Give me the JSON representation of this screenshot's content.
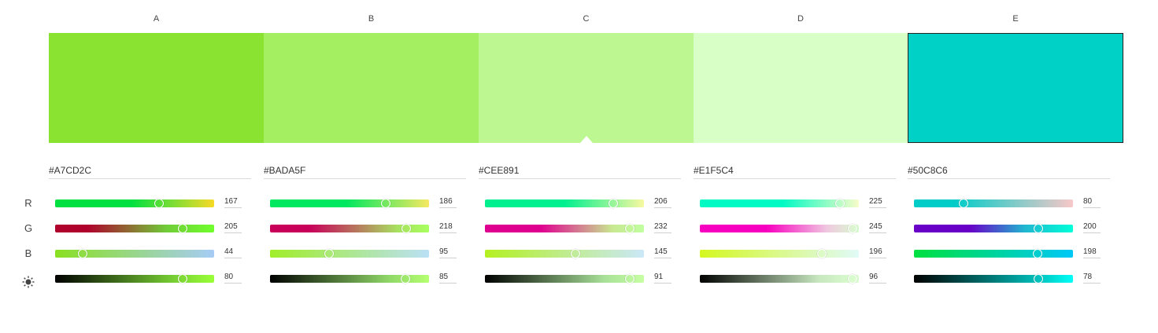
{
  "row_labels": [
    "R",
    "G",
    "B"
  ],
  "brightness_icon": "sun-icon",
  "selected_index": 4,
  "caret_under_index": 2,
  "swatches": [
    {
      "label": "A",
      "color": "#8AE231",
      "hex": "#A7CD2C",
      "r": 167,
      "g": 205,
      "b": 44,
      "brightness": 80,
      "gradients": {
        "r": "linear-gradient(to right,#00E040 0%,#00E040 48%,#F8DA28 100%)",
        "g": "linear-gradient(to right,#B0002C 0%,#B0002C 20%,#70CC38 70%,#70FF2C 100%)",
        "b": "linear-gradient(to right,#8AE020 0%,#A6CCF6 100%)",
        "br": "linear-gradient(to right,#000000 0%,#78D034 75%,#9AFF36 100%)"
      }
    },
    {
      "label": "B",
      "color": "#A3EF61",
      "hex": "#BADA5F",
      "r": 186,
      "g": 218,
      "b": 95,
      "brightness": 85,
      "gradients": {
        "r": "linear-gradient(to right,#00E860 0%,#00E860 48%,#F6E860 100%)",
        "g": "linear-gradient(to right,#C8005A 0%,#C8005A 25%,#A8E060 80%,#A8FF5F 100%)",
        "b": "linear-gradient(to right,#A0EE28 0%,#BAE0F6 100%)",
        "br": "linear-gradient(to right,#000000 0%,#90D868 75%,#B4FF70 100%)"
      }
    },
    {
      "label": "C",
      "color": "#BDF791",
      "hex": "#CEE891",
      "r": 206,
      "g": 232,
      "b": 145,
      "brightness": 91,
      "gradients": {
        "r": "linear-gradient(to right,#00F090 0%,#00F090 50%,#F8F8A0 100%)",
        "g": "linear-gradient(to right,#E00090 0%,#E00090 35%,#C8E890 80%,#C0FFA0 100%)",
        "b": "linear-gradient(to right,#B4F020 0%,#CAE8F8 100%)",
        "br": "linear-gradient(to right,#000000 0%,#A8E098 75%,#C6FFA2 100%)"
      }
    },
    {
      "label": "D",
      "color": "#D8FFC6",
      "hex": "#E1F5C4",
      "r": 225,
      "g": 245,
      "b": 196,
      "brightness": 96,
      "gradients": {
        "r": "linear-gradient(to right,#00FAC4 0%,#00FAC4 52%,#F8FCC8 100%)",
        "g": "linear-gradient(to right,#F800C0 0%,#F800C0 42%,#F0C8E0 80%,#D8FFD0 100%)",
        "b": "linear-gradient(to right,#D4F820 0%,#E0FAF8 100%)",
        "br": "linear-gradient(to right,#000000 0%,#C8E8C0 75%,#DCFFD0 100%)"
      }
    },
    {
      "label": "E",
      "color": "#00D1C7",
      "hex": "#50C8C6",
      "r": 80,
      "g": 200,
      "b": 198,
      "brightness": 78,
      "gradients": {
        "r": "linear-gradient(to right,#00CCC8 0%,#00CCC8 25%,#F8C8C8 100%)",
        "g": "linear-gradient(to right,#6800C8 0%,#6800C8 35%,#20B8D0 70%,#00FFD8 100%)",
        "b": "linear-gradient(to right,#00E040 0%,#00C8F8 100%)",
        "br": "linear-gradient(to right,#000000 0%,#00B8B4 75%,#00FFF8 100%)"
      }
    }
  ]
}
